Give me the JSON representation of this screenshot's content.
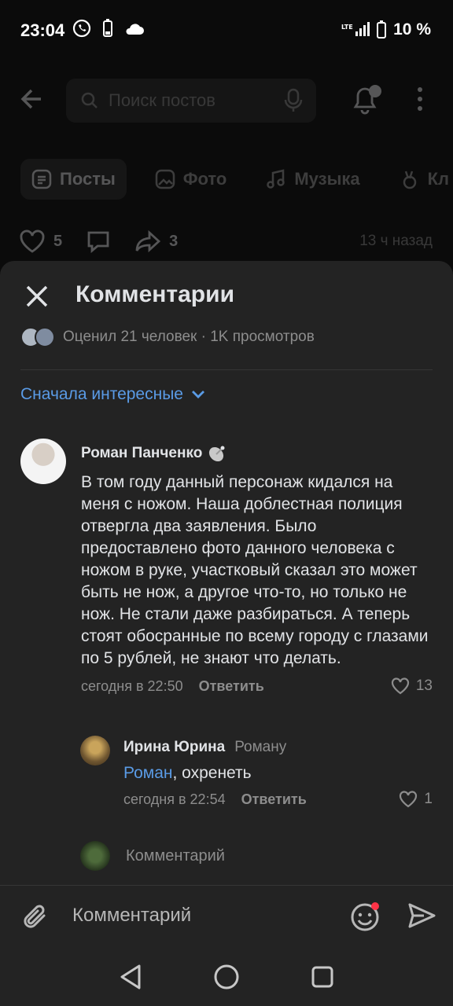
{
  "status_bar": {
    "time": "23:04",
    "battery": "10 %",
    "network": "LTE"
  },
  "background": {
    "search_placeholder": "Поиск постов",
    "tabs": [
      {
        "label": "Посты",
        "icon": "posts-icon"
      },
      {
        "label": "Фото",
        "icon": "photo-icon"
      },
      {
        "label": "Музыка",
        "icon": "music-icon"
      },
      {
        "label": "Кл",
        "icon": "clips-icon"
      }
    ],
    "likes": "5",
    "reposts": "3",
    "time_ago": "13 ч назад"
  },
  "sheet": {
    "title": "Комментарии",
    "summary": "Оценил 21 человек · 1K просмотров",
    "sort_label": "Сначала интересные"
  },
  "comment": {
    "author": "Роман Панченко",
    "text": "В том году данный персонаж кидался на меня с ножом. Наша доблестная полиция отвергла два заявления. Было предоставлено фото данного человека с ножом в руке, участковый сказал это может быть не нож, а другое что-то, но только не нож. Не стали даже разбираться. А теперь стоят обосранные по всему городу с глазами по 5 рублей, не знают что делать.",
    "time": "сегодня в 22:50",
    "reply_label": "Ответить",
    "likes": "13"
  },
  "reply": {
    "author": "Ирина Юрина",
    "to": "Роману",
    "mention": "Роман",
    "text": ", охренеть",
    "time": "сегодня в 22:54",
    "reply_label": "Ответить",
    "likes": "1"
  },
  "reply_input_placeholder": "Комментарий",
  "composer_placeholder": "Комментарий"
}
